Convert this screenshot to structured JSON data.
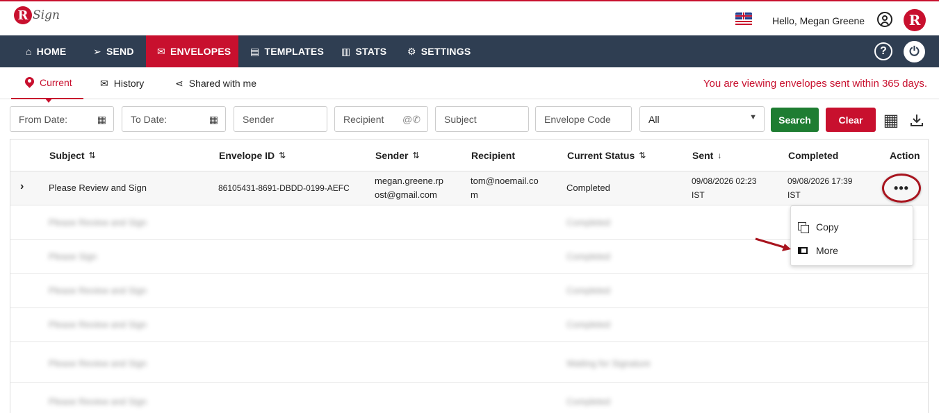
{
  "app": {
    "logo_letter": "R",
    "logo_text": "Sign",
    "greeting": "Hello, Megan Greene",
    "badge_letter": "R"
  },
  "nav": [
    {
      "label": "HOME",
      "icon": "home-icon",
      "glyph": "⌂"
    },
    {
      "label": "SEND",
      "icon": "send-icon",
      "glyph": "➢"
    },
    {
      "label": "ENVELOPES",
      "icon": "envelope-icon",
      "glyph": "✉",
      "active": true
    },
    {
      "label": "TEMPLATES",
      "icon": "document-icon",
      "glyph": "▤"
    },
    {
      "label": "STATS",
      "icon": "chart-icon",
      "glyph": "▥"
    },
    {
      "label": "SETTINGS",
      "icon": "gear-icon",
      "glyph": "⚙"
    }
  ],
  "nav_right": {
    "help_glyph": "?",
    "power_glyph": "⏻"
  },
  "subtabs": [
    {
      "label": "Current",
      "icon": "pin-icon",
      "active": true
    },
    {
      "label": "History",
      "icon": "history-envelope-icon",
      "glyph": "✉"
    },
    {
      "label": "Shared with me",
      "icon": "share-icon",
      "glyph": "⋖"
    }
  ],
  "notice": "You are viewing envelopes sent within 365 days.",
  "filters": {
    "from_date": "From Date:",
    "to_date": "To Date:",
    "sender": "Sender",
    "recipient": "Recipient",
    "subject": "Subject",
    "envelope_code": "Envelope Code",
    "status_selected": "All",
    "search_label": "Search",
    "clear_label": "Clear"
  },
  "table": {
    "headers": {
      "subject": "Subject",
      "envelope_id": "Envelope ID",
      "sender": "Sender",
      "recipient": "Recipient",
      "status": "Current Status",
      "sent": "Sent",
      "completed": "Completed",
      "action": "Action"
    },
    "rows": [
      {
        "subject": "Please Review and Sign",
        "envelope_id": "86105431-8691-DBDD-0199-AEFC",
        "sender_1": "megan.greene.rp",
        "sender_2": "ost@gmail.com",
        "recipient_1": "tom@noemail.co",
        "recipient_2": "m",
        "status": "Completed",
        "sent_1": "09/08/2026 02:23",
        "sent_2": "IST",
        "completed_1": "09/08/2026 17:39",
        "completed_2": "IST",
        "action": "•••"
      }
    ],
    "blurred_rows": [
      {
        "subject": "Please Review and Sign",
        "status": "Completed"
      },
      {
        "subject": "Please Sign",
        "status": "Completed"
      },
      {
        "subject": "Please Review and Sign",
        "status": "Completed"
      },
      {
        "subject": "Please Review and Sign",
        "status": "Completed"
      },
      {
        "subject": "Please Review and Sign",
        "status": "Waiting for Signature"
      },
      {
        "subject": "Please Review and Sign",
        "status": "Completed"
      }
    ]
  },
  "action_menu": [
    {
      "label": "Copy",
      "icon": "copy-icon"
    },
    {
      "label": "More",
      "icon": "more-icon"
    }
  ]
}
